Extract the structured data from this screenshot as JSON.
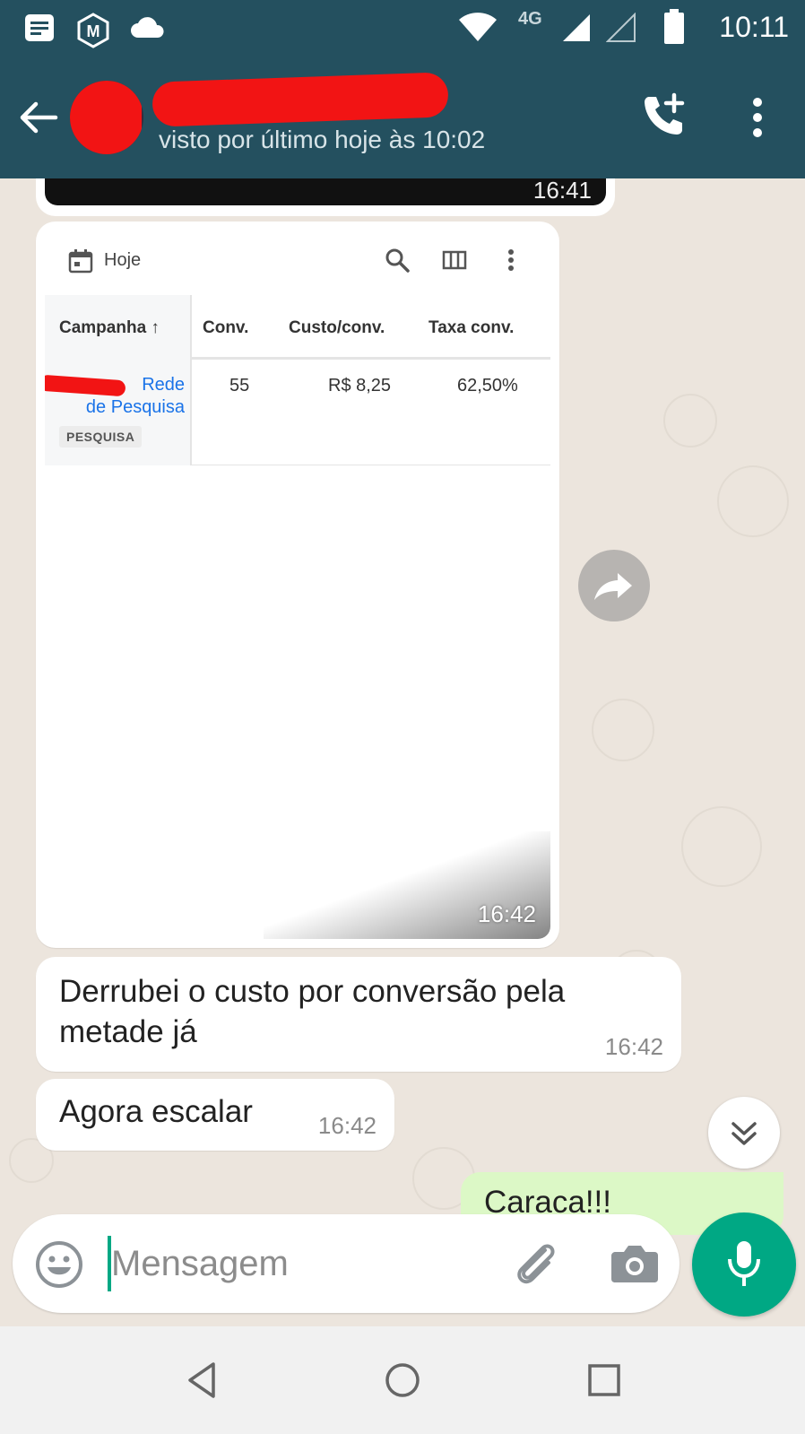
{
  "status_bar": {
    "time": "10:11",
    "network": "4G",
    "icons": [
      "notification-icon",
      "m-app-icon",
      "cloud-icon",
      "wifi-icon",
      "signal-icon",
      "signal-empty-icon",
      "battery-icon"
    ]
  },
  "header": {
    "last_seen": "visto por último hoje às 10:02",
    "accent_color": "#24505f"
  },
  "messages": {
    "prev_image_time": "16:41",
    "screenshot": {
      "date_filter": "Hoje",
      "columns": [
        "Campanha ↑",
        "Conv.",
        "Custo/conv.",
        "Taxa conv."
      ],
      "row": {
        "campaign_line1": "Rede",
        "campaign_line2": "de Pesquisa",
        "tag": "PESQUISA",
        "conv": "55",
        "cost_per_conv": "R$ 8,25",
        "conv_rate": "62,50%"
      },
      "time": "16:42"
    },
    "msg1": {
      "text": "Derrubei o custo por conversão pela metade já",
      "time": "16:42"
    },
    "msg2": {
      "text": "Agora escalar",
      "time": "16:42"
    },
    "outgoing_partial": "Caraca!!!"
  },
  "composer": {
    "placeholder": "Mensagem"
  },
  "colors": {
    "outgoing_bubble": "#dcf8c6",
    "mic_button": "#00a884",
    "redaction": "#f21414"
  }
}
